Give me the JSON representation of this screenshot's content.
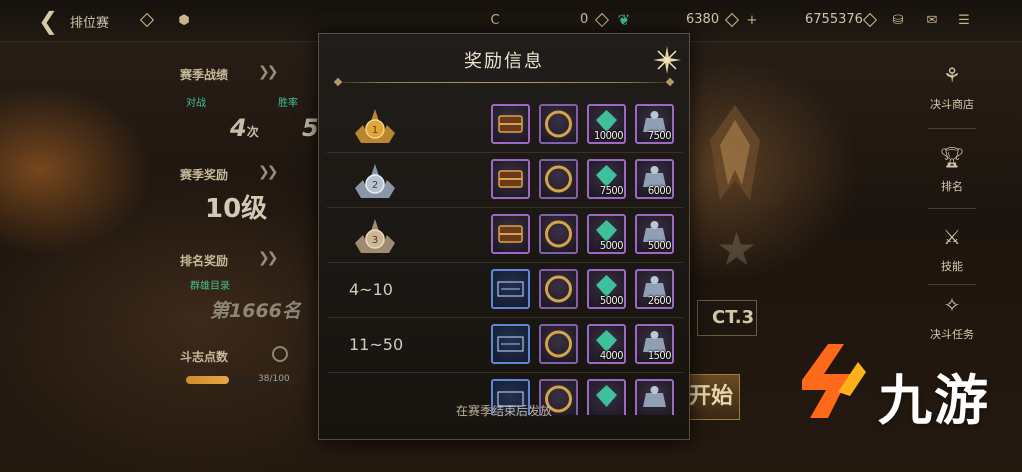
{
  "topbar": {
    "title": "排位赛",
    "currency1": "0",
    "currency2": "6380",
    "currency3": "6755376"
  },
  "left_panel": {
    "season_record_label": "赛季战绩",
    "matches_label": "对战",
    "wins_label": "胜率",
    "matches_value": "4",
    "matches_unit": "次",
    "wins_value": "5",
    "season_reward_label": "赛季奖励",
    "season_level": "10级",
    "rank_reward_label": "排名奖励",
    "rank_badge": "群雄目录",
    "rank_value": "第1666名",
    "duel_points_label": "斗志点数",
    "duel_points_progress": "38/100",
    "duel_points_fraction": 0.38
  },
  "right_rail": {
    "items": [
      {
        "label": "决斗商店",
        "icon": "shop-bag-icon"
      },
      {
        "label": "排名",
        "icon": "trophy-icon"
      },
      {
        "label": "技能",
        "icon": "sword-icon"
      },
      {
        "label": "决斗任务",
        "icon": "quest-icon"
      }
    ]
  },
  "background": {
    "season_tag": "CT.3",
    "start_button": "开始"
  },
  "watermark": {
    "text": "九游"
  },
  "dialog": {
    "title": "奖励信息",
    "footer": "在赛季结束后发放",
    "rows": [
      {
        "rank": "",
        "medal": "gold-medal-icon",
        "medal_number": "1",
        "items": [
          {
            "icon": "treasure-chest-icon",
            "qty": "",
            "frame": "purple"
          },
          {
            "icon": "gold-ring-icon",
            "qty": "",
            "frame": "purple"
          },
          {
            "icon": "green-gem-icon",
            "qty": "10000",
            "frame": "purple"
          },
          {
            "icon": "silver-coin-bag-icon",
            "qty": "7500",
            "frame": "purple"
          }
        ]
      },
      {
        "rank": "",
        "medal": "silver-medal-icon",
        "medal_number": "2",
        "items": [
          {
            "icon": "treasure-chest-icon",
            "qty": "",
            "frame": "purple"
          },
          {
            "icon": "gold-ring-icon",
            "qty": "",
            "frame": "purple"
          },
          {
            "icon": "green-gem-icon",
            "qty": "7500",
            "frame": "purple"
          },
          {
            "icon": "silver-coin-bag-icon",
            "qty": "6000",
            "frame": "purple"
          }
        ]
      },
      {
        "rank": "",
        "medal": "bronze-medal-icon",
        "medal_number": "3",
        "items": [
          {
            "icon": "treasure-chest-icon",
            "qty": "",
            "frame": "purple"
          },
          {
            "icon": "gold-ring-icon",
            "qty": "",
            "frame": "purple"
          },
          {
            "icon": "green-gem-icon",
            "qty": "5000",
            "frame": "purple"
          },
          {
            "icon": "silver-coin-bag-icon",
            "qty": "5000",
            "frame": "purple"
          }
        ]
      },
      {
        "rank": "4~10",
        "medal": "",
        "items": [
          {
            "icon": "title-card-icon",
            "qty": "",
            "frame": "blue"
          },
          {
            "icon": "gold-ring-icon",
            "qty": "",
            "frame": "purple"
          },
          {
            "icon": "green-gem-icon",
            "qty": "5000",
            "frame": "purple"
          },
          {
            "icon": "silver-coin-bag-icon",
            "qty": "2600",
            "frame": "purple"
          }
        ]
      },
      {
        "rank": "11~50",
        "medal": "",
        "items": [
          {
            "icon": "title-card-icon",
            "qty": "",
            "frame": "blue"
          },
          {
            "icon": "gold-ring-icon",
            "qty": "",
            "frame": "purple"
          },
          {
            "icon": "green-gem-icon",
            "qty": "4000",
            "frame": "purple"
          },
          {
            "icon": "silver-coin-bag-icon",
            "qty": "1500",
            "frame": "purple"
          }
        ]
      },
      {
        "rank": "",
        "medal": "",
        "items": [
          {
            "icon": "title-card-icon",
            "qty": "",
            "frame": "blue"
          },
          {
            "icon": "gold-ring-icon",
            "qty": "",
            "frame": "purple"
          },
          {
            "icon": "green-gem-icon",
            "qty": "",
            "frame": "purple"
          },
          {
            "icon": "silver-coin-bag-icon",
            "qty": "",
            "frame": "purple"
          }
        ]
      }
    ]
  }
}
